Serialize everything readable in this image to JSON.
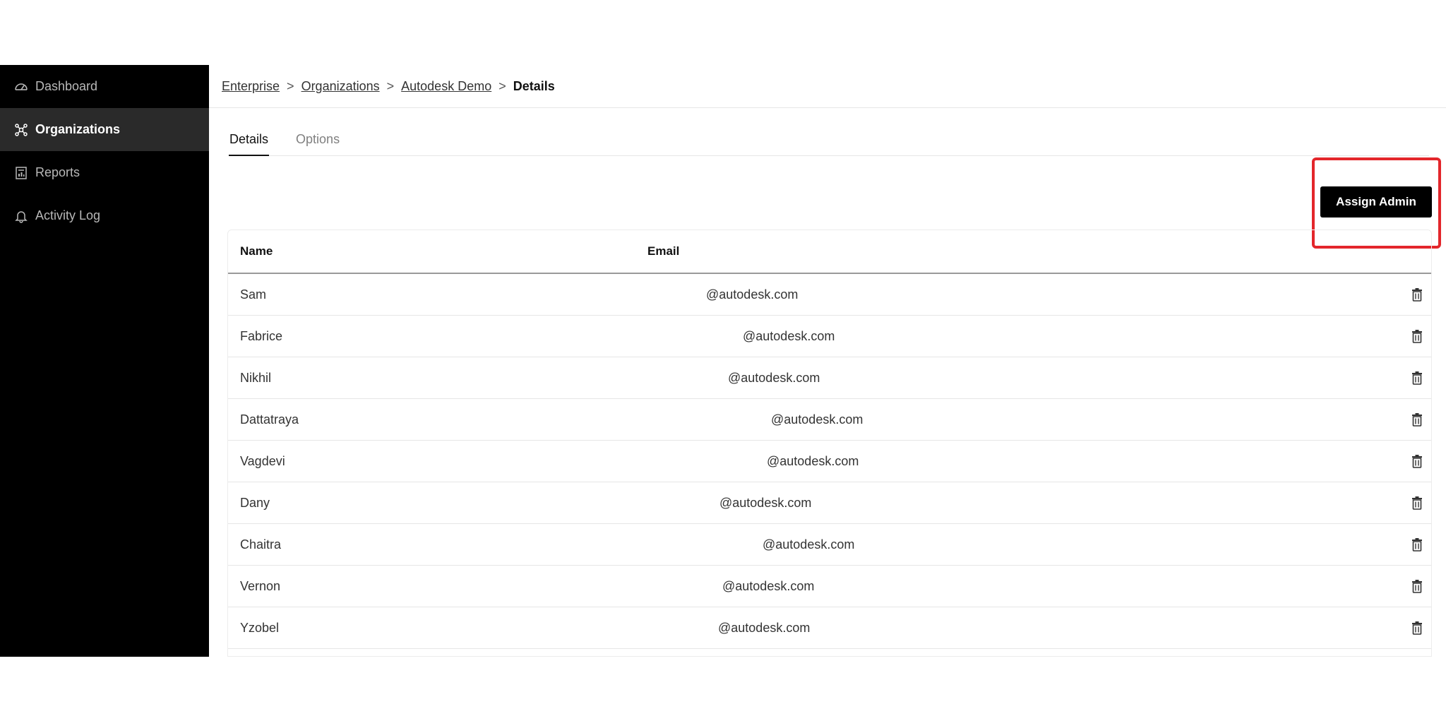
{
  "sidebar": {
    "items": [
      {
        "label": "Dashboard",
        "icon": "dashboard-icon",
        "active": false
      },
      {
        "label": "Organizations",
        "icon": "organizations-icon",
        "active": true
      },
      {
        "label": "Reports",
        "icon": "reports-icon",
        "active": false
      },
      {
        "label": "Activity Log",
        "icon": "bell-icon",
        "active": false
      }
    ]
  },
  "breadcrumb": {
    "items": [
      "Enterprise",
      "Organizations",
      "Autodesk Demo"
    ],
    "separator": ">",
    "current": "Details"
  },
  "tabs": [
    {
      "label": "Details",
      "active": true
    },
    {
      "label": "Options",
      "active": false
    }
  ],
  "actions": {
    "assign_admin_label": "Assign Admin"
  },
  "table": {
    "headers": {
      "name": "Name",
      "email": "Email"
    },
    "rows": [
      {
        "name": "Sam",
        "email": "@autodesk.com"
      },
      {
        "name": "Fabrice",
        "email": "@autodesk.com"
      },
      {
        "name": "Nikhil",
        "email": "@autodesk.com"
      },
      {
        "name": "Dattatraya",
        "email": "@autodesk.com"
      },
      {
        "name": "Vagdevi",
        "email": "@autodesk.com"
      },
      {
        "name": "Dany",
        "email": "@autodesk.com"
      },
      {
        "name": "Chaitra",
        "email": "@autodesk.com"
      },
      {
        "name": "Vernon",
        "email": "@autodesk.com"
      },
      {
        "name": "Yzobel",
        "email": "@autodesk.com"
      }
    ]
  },
  "colors": {
    "sidebar_bg": "#000000",
    "active_item_bg": "#2a2a2a",
    "highlight": "#e3262b",
    "button_bg": "#000000"
  }
}
